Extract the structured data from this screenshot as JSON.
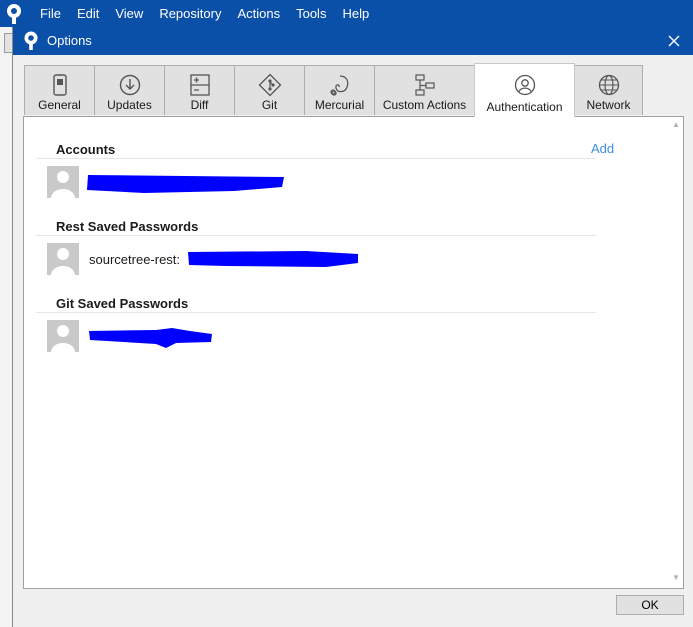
{
  "menubar": {
    "items": [
      "File",
      "Edit",
      "View",
      "Repository",
      "Actions",
      "Tools",
      "Help"
    ]
  },
  "dialog": {
    "title": "Options",
    "close_icon": "close-icon",
    "tabs": [
      {
        "label": "General",
        "icon": "switch-icon",
        "active": false
      },
      {
        "label": "Updates",
        "icon": "download-arrow-icon",
        "active": false
      },
      {
        "label": "Diff",
        "icon": "diff-icon",
        "active": false
      },
      {
        "label": "Git",
        "icon": "git-icon",
        "active": false
      },
      {
        "label": "Mercurial",
        "icon": "mercurial-icon",
        "active": false
      },
      {
        "label": "Custom Actions",
        "icon": "flowchart-icon",
        "active": false
      },
      {
        "label": "Authentication",
        "icon": "user-circle-icon",
        "active": true
      },
      {
        "label": "Network",
        "icon": "globe-icon",
        "active": false
      }
    ],
    "ok_label": "OK"
  },
  "authentication": {
    "accounts": {
      "title": "Accounts",
      "add_label": "Add"
    },
    "rest_passwords": {
      "title": "Rest Saved Passwords",
      "entry_prefix": "sourcetree-rest:"
    },
    "git_passwords": {
      "title": "Git Saved Passwords"
    }
  },
  "colors": {
    "titlebar": "#0b50a8",
    "link": "#3d8fe0",
    "redaction": "#0000ff"
  }
}
